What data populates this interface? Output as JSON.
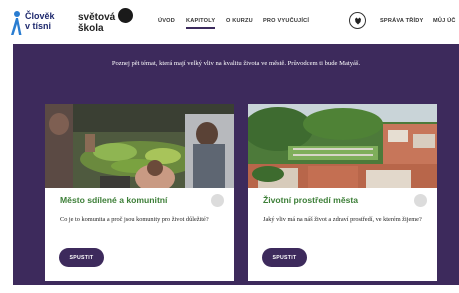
{
  "header": {
    "logo1": {
      "line1": "Člověk",
      "line2": "v tísni"
    },
    "logo2": {
      "line1": "světová",
      "line2": "škola"
    },
    "nav": [
      {
        "label": "ÚVOD",
        "active": false
      },
      {
        "label": "KAPITOLY",
        "active": true
      },
      {
        "label": "O KURZU",
        "active": false
      },
      {
        "label": "PRO VYUČUJÍCÍ",
        "active": false
      },
      {
        "label": "SPRÁVA TŘÍDY",
        "active": false
      },
      {
        "label": "MŮJ ÚČ",
        "active": false
      }
    ],
    "icon": "shield-crest-icon"
  },
  "intro": "Poznej pět témat, která mají velký vliv na kvalitu života ve městě. Průvodcem ti bude Matyáš.",
  "cards": [
    {
      "title": "Město sdílené a komunitní",
      "description": "Co je to komunita a proč jsou komunity pro život důležité?",
      "button": "SPUSTIT"
    },
    {
      "title": "Životní prostředí města",
      "description": "Jaký vliv má na náš život a zdraví prostředí, ve kterém žijeme?",
      "button": "SPUSTIT"
    }
  ],
  "colors": {
    "brand_purple": "#3d2a5c",
    "title_green": "#3d7f38",
    "logo_blue": "#1f2a6e"
  }
}
